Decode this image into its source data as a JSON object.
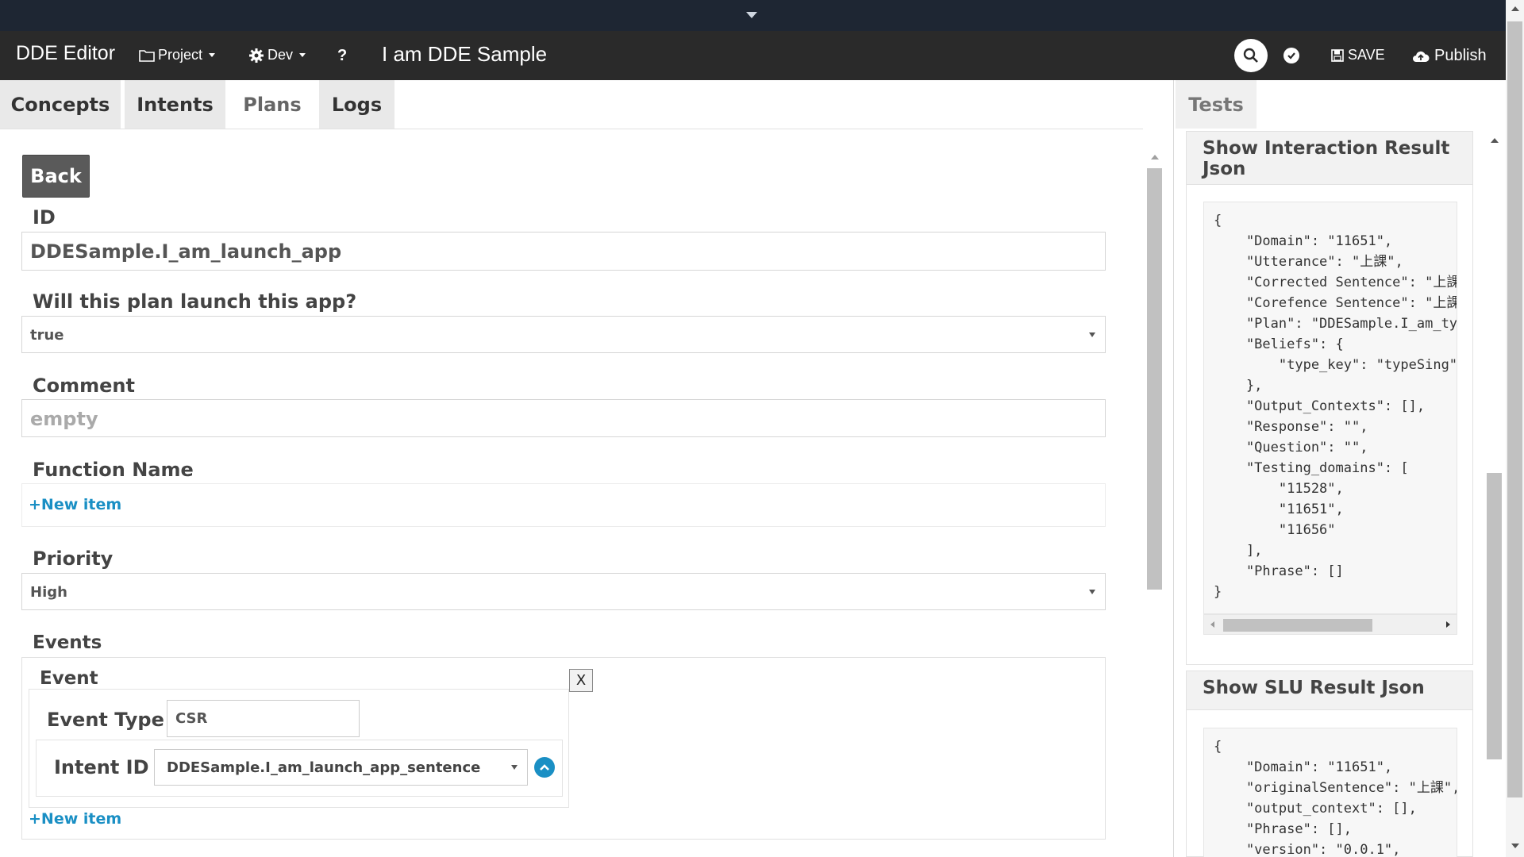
{
  "navbar": {
    "brand": "DDE Editor",
    "project_label": "Project",
    "env_label": "Dev",
    "help_label": "?",
    "app_title": "I am DDE Sample",
    "save_label": "SAVE",
    "publish_label": "Publish"
  },
  "tabs": [
    "Concepts",
    "Intents",
    "Plans",
    "Logs"
  ],
  "active_tab": "Plans",
  "right_tab": "Tests",
  "form": {
    "back_label": "Back",
    "id_label": "ID",
    "id_value": "DDESample.I_am_launch_app",
    "launch_label": "Will this plan launch this app?",
    "launch_value": "true",
    "comment_label": "Comment",
    "comment_placeholder": "empty",
    "function_label": "Function Name",
    "new_item_label": "+New item",
    "priority_label": "Priority",
    "priority_value": "High",
    "events_label": "Events",
    "event_title": "Event",
    "close_label": "X",
    "event_type_label": "Event Type",
    "event_type_value": "CSR",
    "intent_id_label": "Intent ID",
    "intent_id_value": "DDESample.I_am_launch_app_sentence"
  },
  "tests": {
    "interaction_title": "Show Interaction Result Json",
    "interaction_json": "{\n    \"Domain\": \"11651\",\n    \"Utterance\": \"上課\",\n    \"Corrected Sentence\": \"上課\",\n    \"Corefence Sentence\": \"上課\",\n    \"Plan\": \"DDESample.I_am_type\",\n    \"Beliefs\": {\n        \"type_key\": \"typeSing\"\n    },\n    \"Output_Contexts\": [],\n    \"Response\": \"\",\n    \"Question\": \"\",\n    \"Testing_domains\": [\n        \"11528\",\n        \"11651\",\n        \"11656\"\n    ],\n    \"Phrase\": []\n}",
    "slu_title": "Show SLU Result Json",
    "slu_json": "{\n    \"Domain\": \"11651\",\n    \"originalSentence\": \"上課\",\n    \"output_context\": [],\n    \"Phrase\": [],\n    \"version\": \"0.0.1\","
  }
}
